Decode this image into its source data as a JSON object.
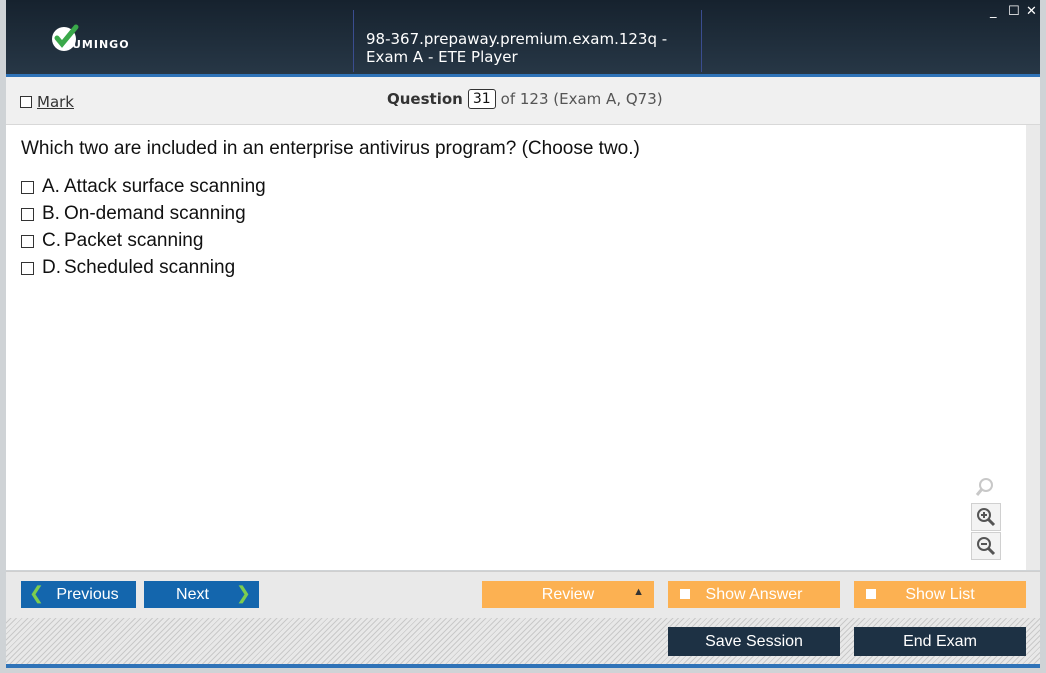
{
  "window": {
    "title": "98-367.prepaway.premium.exam.123q - Exam A - ETE Player",
    "logo_text": "UMINGO",
    "controls": [
      "_",
      "☐",
      "✕"
    ]
  },
  "header": {
    "mark_label": "Mark",
    "question_label": "Question",
    "question_number": "31",
    "question_of": "of 123 (Exam A, Q73)"
  },
  "question": {
    "text": "Which two are included in an enterprise antivirus program? (Choose two.)",
    "options": [
      {
        "letter": "A.",
        "text": "Attack surface scanning"
      },
      {
        "letter": "B.",
        "text": "On-demand scanning"
      },
      {
        "letter": "C.",
        "text": "Packet scanning"
      },
      {
        "letter": "D.",
        "text": "Scheduled scanning"
      }
    ]
  },
  "zoom_icons": [
    "search-icon",
    "zoom-in-icon",
    "zoom-out-icon"
  ],
  "nav": {
    "previous": "Previous",
    "next": "Next",
    "review": "Review",
    "show_answer": "Show Answer",
    "show_list": "Show List"
  },
  "footer": {
    "save_session": "Save Session",
    "end_exam": "End Exam"
  },
  "colors": {
    "accent_blue": "#1466ad",
    "orange": "#fcb152",
    "dark": "#1d3144",
    "check_green": "#7ccd4f"
  }
}
